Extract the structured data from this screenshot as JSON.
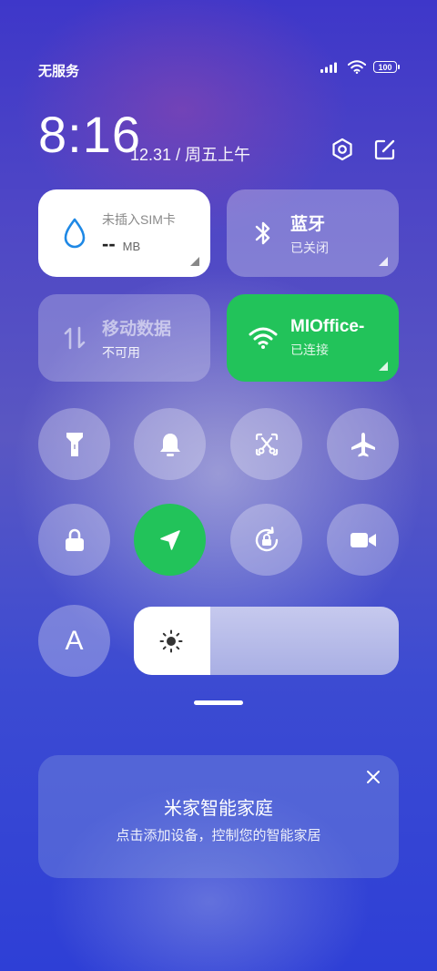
{
  "status_bar": {
    "carrier": "无服务",
    "battery": "100",
    "icons": [
      "signal-icon",
      "wifi-icon",
      "battery-icon"
    ]
  },
  "header": {
    "time": "8:16",
    "date": "12.31 / 周五上午",
    "icons": [
      "settings-icon",
      "edit-icon"
    ]
  },
  "tiles": {
    "data_usage": {
      "title": "未插入SIM卡",
      "value": "--",
      "unit": "MB",
      "icon": "water-drop-icon"
    },
    "bluetooth": {
      "title": "蓝牙",
      "sub": "已关闭",
      "icon": "bluetooth-icon"
    },
    "mobile_data": {
      "title": "移动数据",
      "sub": "不可用",
      "icon": "data-arrows-icon"
    },
    "wifi": {
      "title": "MIOffice-",
      "sub": "已连接",
      "icon": "wifi-icon"
    }
  },
  "toggles": [
    {
      "name": "flashlight",
      "icon": "flashlight-icon",
      "on": false
    },
    {
      "name": "silent",
      "icon": "bell-icon",
      "on": false
    },
    {
      "name": "screenshot",
      "icon": "screenshot-scissors-icon",
      "on": false
    },
    {
      "name": "airplane",
      "icon": "airplane-icon",
      "on": false
    },
    {
      "name": "lock",
      "icon": "lock-icon",
      "on": false
    },
    {
      "name": "location",
      "icon": "location-arrow-icon",
      "on": true
    },
    {
      "name": "rotation-lock",
      "icon": "rotation-lock-icon",
      "on": false
    },
    {
      "name": "screen-record",
      "icon": "video-camera-icon",
      "on": false
    }
  ],
  "font_button": {
    "label": "A"
  },
  "brightness": {
    "level": 0.29,
    "icon": "sun-icon"
  },
  "mijia_card": {
    "title": "米家智能家庭",
    "subtitle": "点击添加设备，控制您的智能家居"
  },
  "colors": {
    "accent_green": "#22c35a"
  }
}
